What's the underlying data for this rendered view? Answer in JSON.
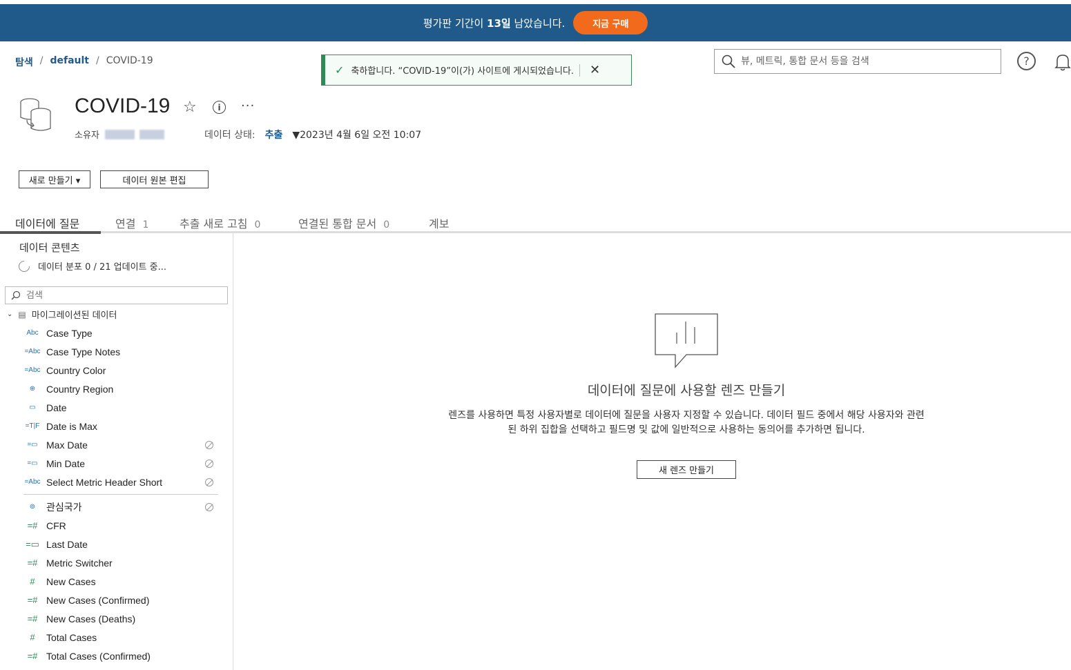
{
  "banner": {
    "message_pre": "평가판 기간이 ",
    "message_days": "13일",
    "message_post": " 남았습니다.",
    "buy_label": "지금 구매",
    "color": "#1f5a8a",
    "buy_color": "#f26b1d"
  },
  "breadcrumb": {
    "explore": "탐색",
    "project": "default",
    "current": "COVID-19",
    "separator": "/"
  },
  "toast": {
    "message": "축하합니다. “COVID-19”이(가) 사이트에 게시되었습니다.",
    "close": "✕"
  },
  "search": {
    "placeholder": "뷰, 메트릭, 통합 문서 등을 검색"
  },
  "header": {
    "title": "COVID-19",
    "owner_label": "소유자",
    "status_label": "데이터 상태:",
    "status_value": "추출",
    "status_date": "▼2023년 4월 6일 오전 10:07"
  },
  "actions": {
    "new_label": "새로 만들기 ▾",
    "edit_label": "데이터 원본 편집"
  },
  "tabs": [
    {
      "label": "데이터에 질문",
      "count": ""
    },
    {
      "label": "연결",
      "count": "1"
    },
    {
      "label": "추출 새로 고침",
      "count": "0"
    },
    {
      "label": "연결된 통합 문서",
      "count": "0"
    },
    {
      "label": "계보",
      "count": ""
    }
  ],
  "sidebar": {
    "title": "데이터 콘텐츠",
    "progress": "데이터 분포 0 / 21 업데이트 중...",
    "search_placeholder": "검색",
    "folder": "마이그레이션된 데이터",
    "fields": [
      {
        "icon": "Abc",
        "name": "Case Type",
        "hidden": false
      },
      {
        "icon": "=Abc",
        "name": "Case Type Notes",
        "hidden": false
      },
      {
        "icon": "=Abc",
        "name": "Country Color",
        "hidden": false
      },
      {
        "icon": "⊕",
        "name": "Country Region",
        "hidden": false
      },
      {
        "icon": "▭",
        "name": "Date",
        "hidden": false
      },
      {
        "icon": "=T|F",
        "name": "Date is Max",
        "hidden": false
      },
      {
        "icon": "=▭",
        "name": "Max Date",
        "hidden": true
      },
      {
        "icon": "=▭",
        "name": "Min Date",
        "hidden": true
      },
      {
        "icon": "=Abc",
        "name": "Select Metric Header Short",
        "hidden": true
      }
    ],
    "fields2": [
      {
        "icon": "⊚",
        "name": "관심국가",
        "hidden": true,
        "green": false
      },
      {
        "icon": "=#",
        "name": "CFR",
        "hidden": false,
        "green": true
      },
      {
        "icon": "=▭",
        "name": "Last Date",
        "hidden": false,
        "green": true
      },
      {
        "icon": "=#",
        "name": "Metric Switcher",
        "hidden": false,
        "green": true
      },
      {
        "icon": "#",
        "name": "New Cases",
        "hidden": false,
        "green": true
      },
      {
        "icon": "=#",
        "name": "New Cases (Confirmed)",
        "hidden": false,
        "green": true
      },
      {
        "icon": "=#",
        "name": "New Cases (Deaths)",
        "hidden": false,
        "green": true
      },
      {
        "icon": "#",
        "name": "Total Cases",
        "hidden": false,
        "green": true
      },
      {
        "icon": "=#",
        "name": "Total Cases (Confirmed)",
        "hidden": false,
        "green": true
      }
    ]
  },
  "empty_state": {
    "title": "데이터에 질문에 사용할 렌즈 만들기",
    "description": "렌즈를 사용하면 특정 사용자별로 데이터에 질문을 사용자 지정할 수 있습니다. 데이터 필드 중에서 해당 사용자와 관련된 하위 집합을 선택하고 필드명 및 값에 일반적으로 사용하는 동의어를 추가하면 됩니다.",
    "button": "새 렌즈 만들기"
  }
}
